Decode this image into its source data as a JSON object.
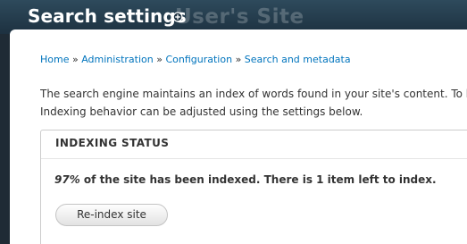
{
  "header": {
    "title": "Search settings",
    "site_name": "User's Site",
    "shortcut_icon": "add-shortcut-icon"
  },
  "breadcrumb": {
    "items": [
      "Home",
      "Administration",
      "Configuration",
      "Search and metadata"
    ],
    "separator": "»"
  },
  "intro": {
    "line1": "The search engine maintains an index of words found in your site's content. To build and maintain this index, a correctly configured cron maintenance task is required.",
    "line2": "Indexing behavior can be adjusted using the settings below."
  },
  "indexing_status": {
    "legend": "INDEXING STATUS",
    "percent": "97%",
    "status_text": "of the site has been indexed. There is 1 item left to index.",
    "reindex_label": "Re-index site"
  },
  "colors": {
    "header_bg": "#1d3140",
    "link": "#0074bd",
    "text": "#333333"
  }
}
